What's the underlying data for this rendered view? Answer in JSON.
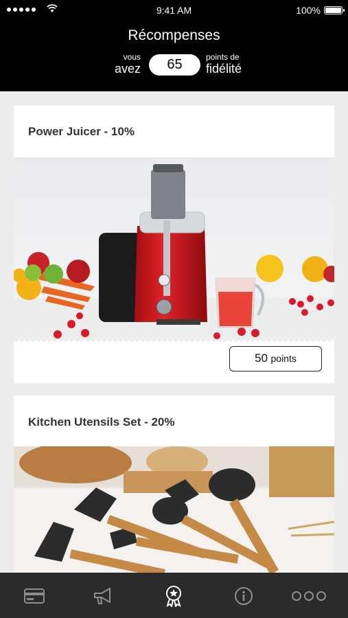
{
  "status": {
    "time": "9:41 AM",
    "battery": "100%"
  },
  "header": {
    "title": "Récompenses",
    "left_small": "vous",
    "left_big": "avez",
    "points": "65",
    "right_small": "points de",
    "right_big": "fidélité"
  },
  "rewards": [
    {
      "title": "Power Juicer - 10%",
      "points_value": "50",
      "points_unit": "points"
    },
    {
      "title": "Kitchen Utensils Set - 20%"
    }
  ],
  "tabs": [
    {
      "name": "card-icon"
    },
    {
      "name": "megaphone-icon"
    },
    {
      "name": "rewards-badge-icon",
      "active": true
    },
    {
      "name": "info-icon"
    },
    {
      "name": "more-icon"
    }
  ],
  "colors": {
    "header_bg": "#000000",
    "tabbar_bg": "#2a2c2c",
    "tab_icon": "#8e8e8e",
    "tab_icon_active": "#ffffff",
    "page_bg": "#ececec"
  }
}
